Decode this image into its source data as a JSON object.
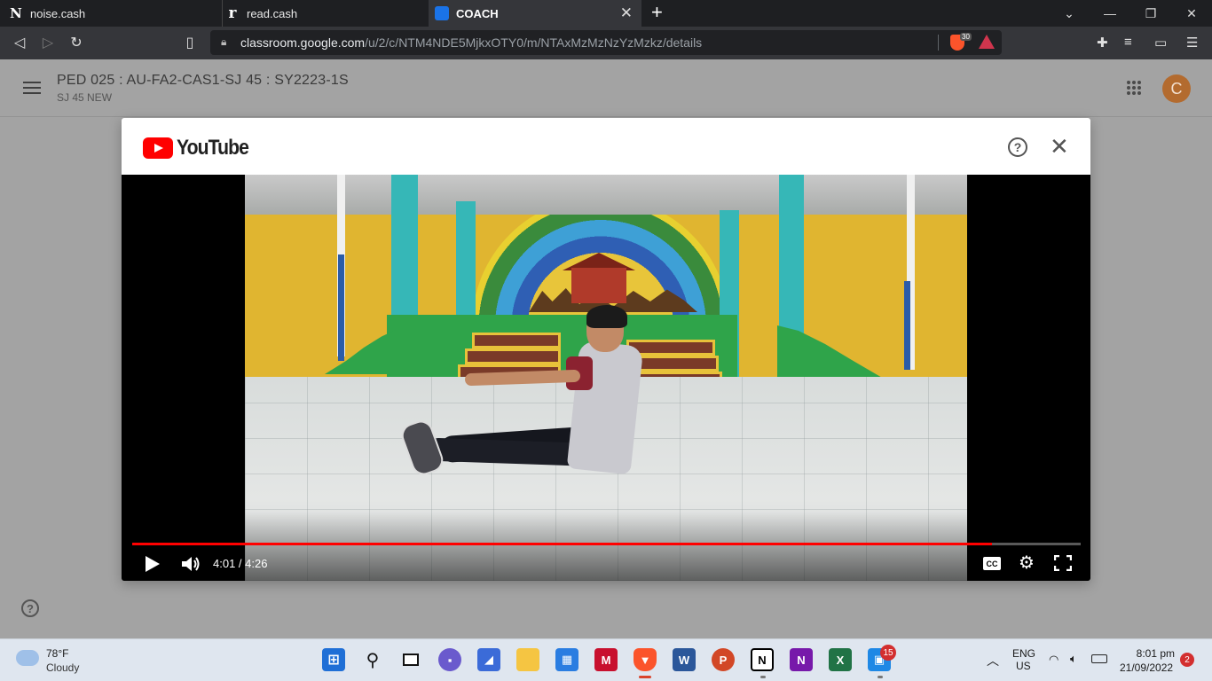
{
  "browser": {
    "tabs": [
      {
        "label": "noise.cash",
        "icon": "noise-cash-icon"
      },
      {
        "label": "read.cash",
        "icon": "read-cash-icon"
      },
      {
        "label": "COACH",
        "icon": "google-classroom-icon",
        "active": true
      }
    ],
    "url": {
      "host": "classroom.google.com",
      "path": "/u/2/c/NTM4NDE5MjkxOTY0/m/NTAxMzMzNzYzMzkz/details"
    },
    "shield_count": "30"
  },
  "classroom": {
    "course_title": "PED 025 : AU-FA2-CAS1-SJ 45 : SY2223-1S",
    "course_section": "SJ 45 NEW",
    "avatar_letter": "C"
  },
  "modal": {
    "brand": "YouTube",
    "player": {
      "time": "4:01 / 4:26",
      "progress": 0.906,
      "cc_label": "CC"
    }
  },
  "taskbar": {
    "weather": {
      "temp": "78°F",
      "condition": "Cloudy"
    },
    "apps": [
      "windows-start-icon",
      "search-icon",
      "task-view-icon",
      "chat-icon",
      "vscode-icon",
      "file-explorer-icon",
      "ms-store-icon",
      "mcafee-icon",
      "brave-icon",
      "word-icon",
      "powerpoint-icon",
      "notion-icon",
      "onenote-icon",
      "excel-icon",
      "teams-icon"
    ],
    "teams_badge": "15",
    "language": {
      "line1": "ENG",
      "line2": "US"
    },
    "clock": {
      "time": "8:01 pm",
      "date": "21/09/2022"
    },
    "notification_count": "2"
  }
}
